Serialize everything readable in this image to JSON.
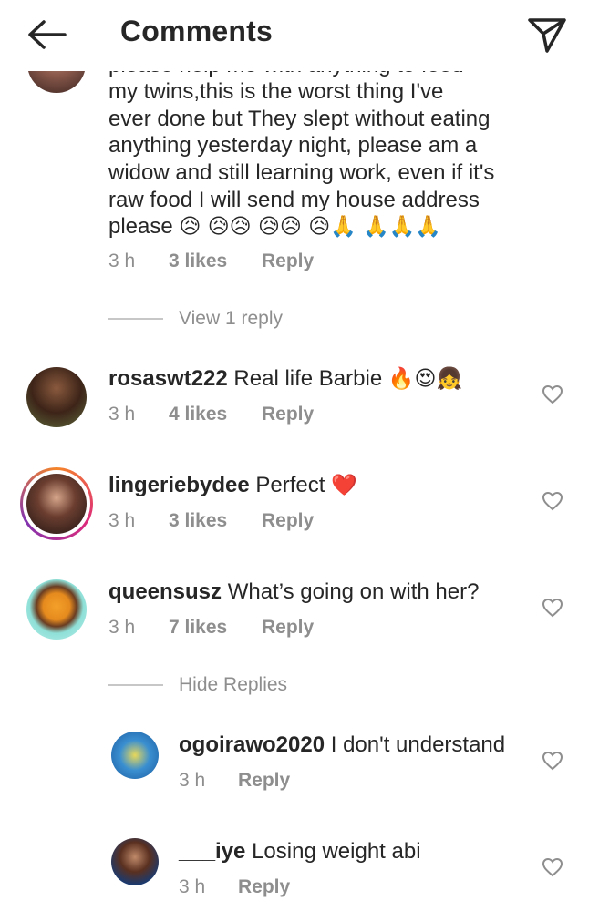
{
  "header": {
    "title": "Comments",
    "back_icon": "arrow-left-icon",
    "send_icon": "paper-plane-icon"
  },
  "first_comment": {
    "lines": [
      "please help me with anything to feed",
      "my twins,this is the worst thing I've",
      "ever done but They slept without eating",
      "anything yesterday night, please am a",
      "widow and still learning work, even if it's",
      "raw food I will send my house address"
    ],
    "last_line_text": "please",
    "last_line_emojis": "😥 😥😥 😥😥 😥🙏 🙏🙏🙏",
    "time": "3 h",
    "likes": "3 likes",
    "reply": "Reply"
  },
  "view_replies": "View 1 reply",
  "comments": [
    {
      "username": "rosaswt222",
      "text": "Real life Barbie",
      "emojis": "🔥😍👧",
      "time": "3 h",
      "likes": "4 likes",
      "reply": "Reply"
    },
    {
      "username": "lingeriebydee",
      "text": "Perfect",
      "emojis": "❤️",
      "time": "3 h",
      "likes": "3 likes",
      "reply": "Reply"
    },
    {
      "username": "queensusz",
      "text": "What’s going on with her?",
      "emojis": "",
      "time": "3 h",
      "likes": "7 likes",
      "reply": "Reply"
    }
  ],
  "hide_replies": "Hide Replies",
  "replies": [
    {
      "username": "ogoirawo2020",
      "text": "I don't understand",
      "time": "3 h",
      "reply": "Reply"
    },
    {
      "username": "___iye",
      "text": "Losing weight abi",
      "time": "3 h",
      "reply": "Reply"
    }
  ],
  "colors": {
    "text": "#262626",
    "secondary": "#8e8e8e",
    "divider": "#c7c7c7",
    "heart": "#8e8e8e",
    "emoji_red": "#e0245e"
  }
}
